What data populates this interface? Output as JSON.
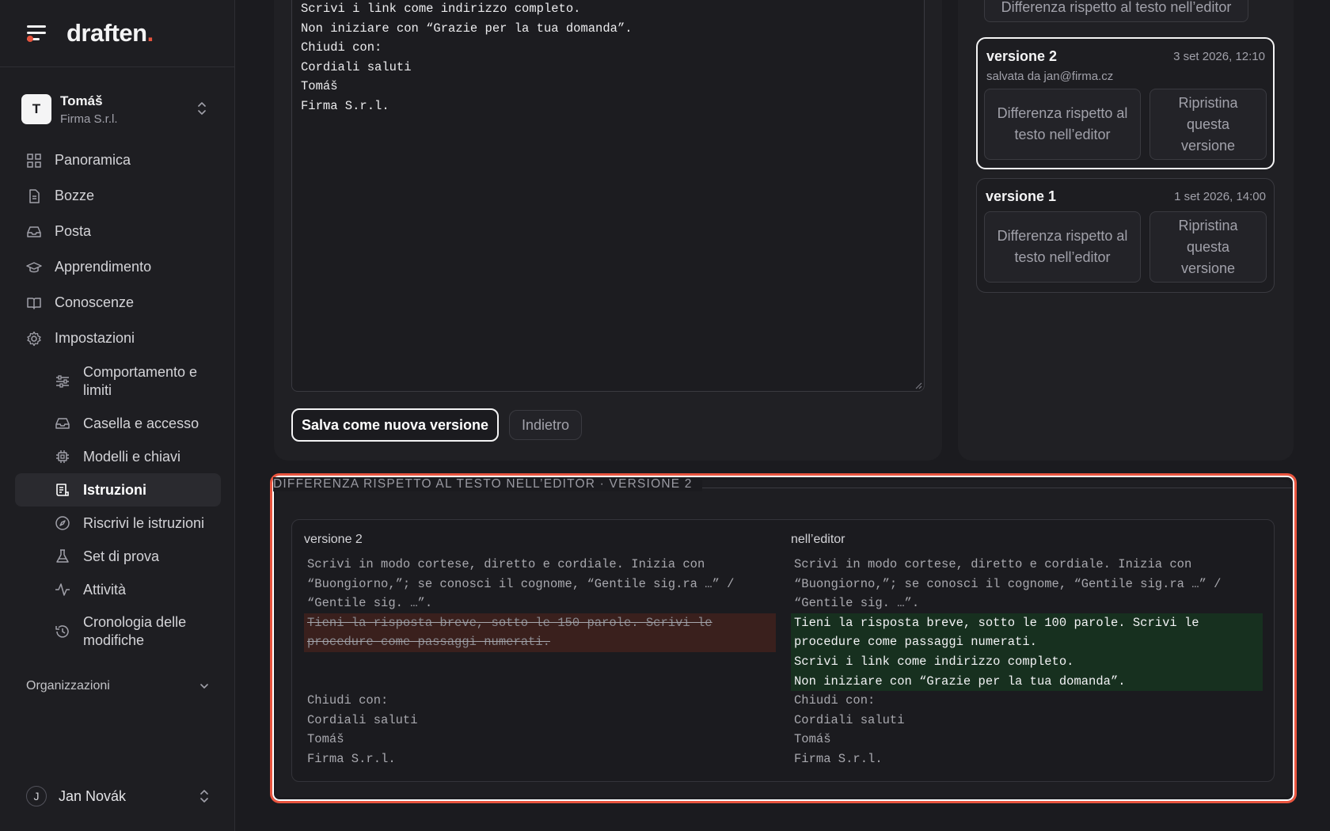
{
  "brand": {
    "name": "draften",
    "dot": "."
  },
  "account": {
    "initial": "T",
    "name": "Tomáš",
    "org": "Firma S.r.l."
  },
  "nav": {
    "items": [
      {
        "label": "Panoramica",
        "icon": "dashboard-icon"
      },
      {
        "label": "Bozze",
        "icon": "document-icon"
      },
      {
        "label": "Posta",
        "icon": "inbox-icon"
      },
      {
        "label": "Apprendimento",
        "icon": "graduation-cap-icon"
      },
      {
        "label": "Conoscenze",
        "icon": "book-icon"
      },
      {
        "label": "Impostazioni",
        "icon": "gear-icon"
      }
    ],
    "settings_items": [
      {
        "label": "Comportamento e limiti",
        "icon": "sliders-icon"
      },
      {
        "label": "Casella e accesso",
        "icon": "inbox-icon"
      },
      {
        "label": "Modelli e chiavi",
        "icon": "chip-icon"
      },
      {
        "label": "Istruzioni",
        "icon": "instructions-icon",
        "active": true
      },
      {
        "label": "Riscrivi le istruzioni",
        "icon": "compass-icon"
      },
      {
        "label": "Set di prova",
        "icon": "flask-icon"
      },
      {
        "label": "Attività",
        "icon": "activity-icon"
      },
      {
        "label": "Cronologia delle modifiche",
        "icon": "history-icon"
      }
    ]
  },
  "organizations_label": "Organizzazioni",
  "user": {
    "initial": "J",
    "name": "Jan Novák"
  },
  "editor": {
    "lines": [
      "Scrivi i link come indirizzo completo.",
      "Non iniziare con “Grazie per la tua domanda”.",
      "Chiudi con:",
      "Cordiali saluti",
      "Tomáš",
      "Firma S.r.l."
    ],
    "save_label": "Salva come nuova versione",
    "back_label": "Indietro"
  },
  "versions": {
    "top_diff_label": "Differenza rispetto al testo nell’editor",
    "list": [
      {
        "title": "versione 2",
        "date": "3 set 2026, 12:10",
        "saved_by": "salvata da jan@firma.cz",
        "diff_label": "Differenza rispetto al testo nell’editor",
        "restore_label": "Ripristina questa versione"
      },
      {
        "title": "versione 1",
        "date": "1 set 2026, 14:00",
        "diff_label": "Differenza rispetto al testo nell’editor",
        "restore_label": "Ripristina questa versione"
      }
    ]
  },
  "diff": {
    "heading": "DIFFERENZA RISPETTO AL TESTO NELL’EDITOR · VERSIONE 2",
    "left": {
      "title": "versione 2",
      "common_top": "Scrivi in modo cortese, diretto e cordiale. Inizia con “Buongiorno,”; se conosci il cognome, “Gentile sig.ra …” / “Gentile sig. …”.",
      "removed": "Tieni la risposta breve, sotto le 150 parole. Scrivi le procedure come passaggi numerati.",
      "common_bottom": [
        "Chiudi con:",
        "Cordiali saluti",
        "Tomáš",
        "Firma S.r.l."
      ]
    },
    "right": {
      "title": "nell’editor",
      "common_top": "Scrivi in modo cortese, diretto e cordiale. Inizia con “Buongiorno,”; se conosci il cognome, “Gentile sig.ra …” / “Gentile sig. …”.",
      "added": [
        "Tieni la risposta breve, sotto le 100 parole. Scrivi le procedure come passaggi numerati.",
        "Scrivi i link come indirizzo completo.",
        "Non iniziare con “Grazie per la tua domanda”."
      ],
      "common_bottom": [
        "Chiudi con:",
        "Cordiali saluti",
        "Tomáš",
        "Firma S.r.l."
      ]
    }
  },
  "colors": {
    "accent": "#e9553f",
    "removed_bg": "#3a201d",
    "added_bg": "#17301f"
  }
}
